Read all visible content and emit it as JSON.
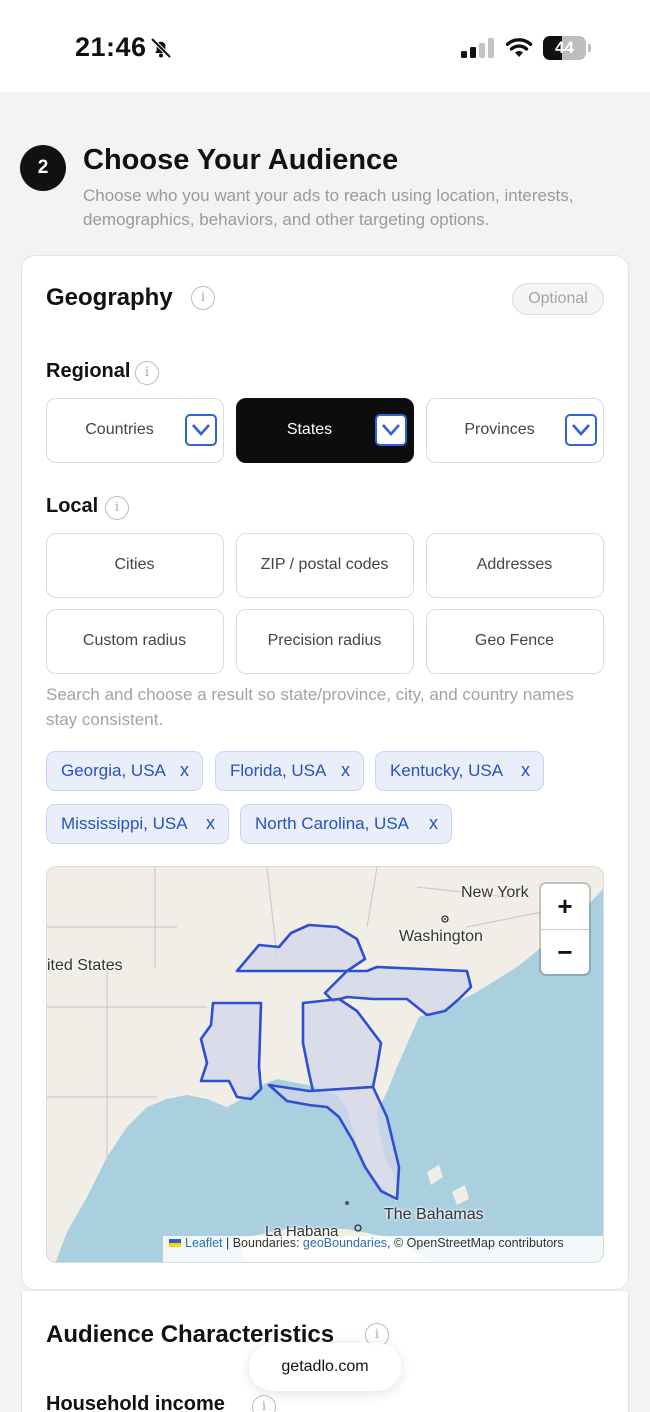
{
  "status_bar": {
    "time": "21:46",
    "battery": "44",
    "battery_level": 0.44
  },
  "step": {
    "number": "2",
    "title": "Choose Your Audience",
    "description": "Choose who you want your ads to reach using location, interests, demographics, behaviors, and other targeting options."
  },
  "geography": {
    "title": "Geography",
    "info": "i",
    "optional": "Optional",
    "regional": {
      "label": "Regional",
      "options": [
        "Countries",
        "States",
        "Provinces"
      ],
      "selected": "States"
    },
    "local": {
      "label": "Local",
      "options": [
        "Cities",
        "ZIP / postal codes",
        "Addresses",
        "Custom radius",
        "Precision radius",
        "Geo Fence"
      ]
    },
    "hint": "Search and choose a result so state/province, city, and country names stay consistent.",
    "chips": [
      "Georgia, USA",
      "Florida, USA",
      "Kentucky, USA",
      "Mississippi, USA",
      "North Carolina, USA"
    ],
    "chip_remove": "x",
    "map": {
      "zoom_in": "+",
      "zoom_out": "−",
      "labels": {
        "new_york": "New York",
        "washington": "Washington",
        "united_states": "ited States",
        "bahamas": "The Bahamas",
        "habana": "La Habana"
      },
      "attribution": {
        "leaflet": "Leaflet",
        "sep": " | Boundaries: ",
        "geo": "geoBoundaries",
        "rest": ", © OpenStreetMap contributors"
      },
      "highlight_color": "#2d4fd0"
    }
  },
  "audience": {
    "title": "Audience Characteristics",
    "household_income": "Household income"
  },
  "browser": {
    "url": "getadlo.com"
  }
}
